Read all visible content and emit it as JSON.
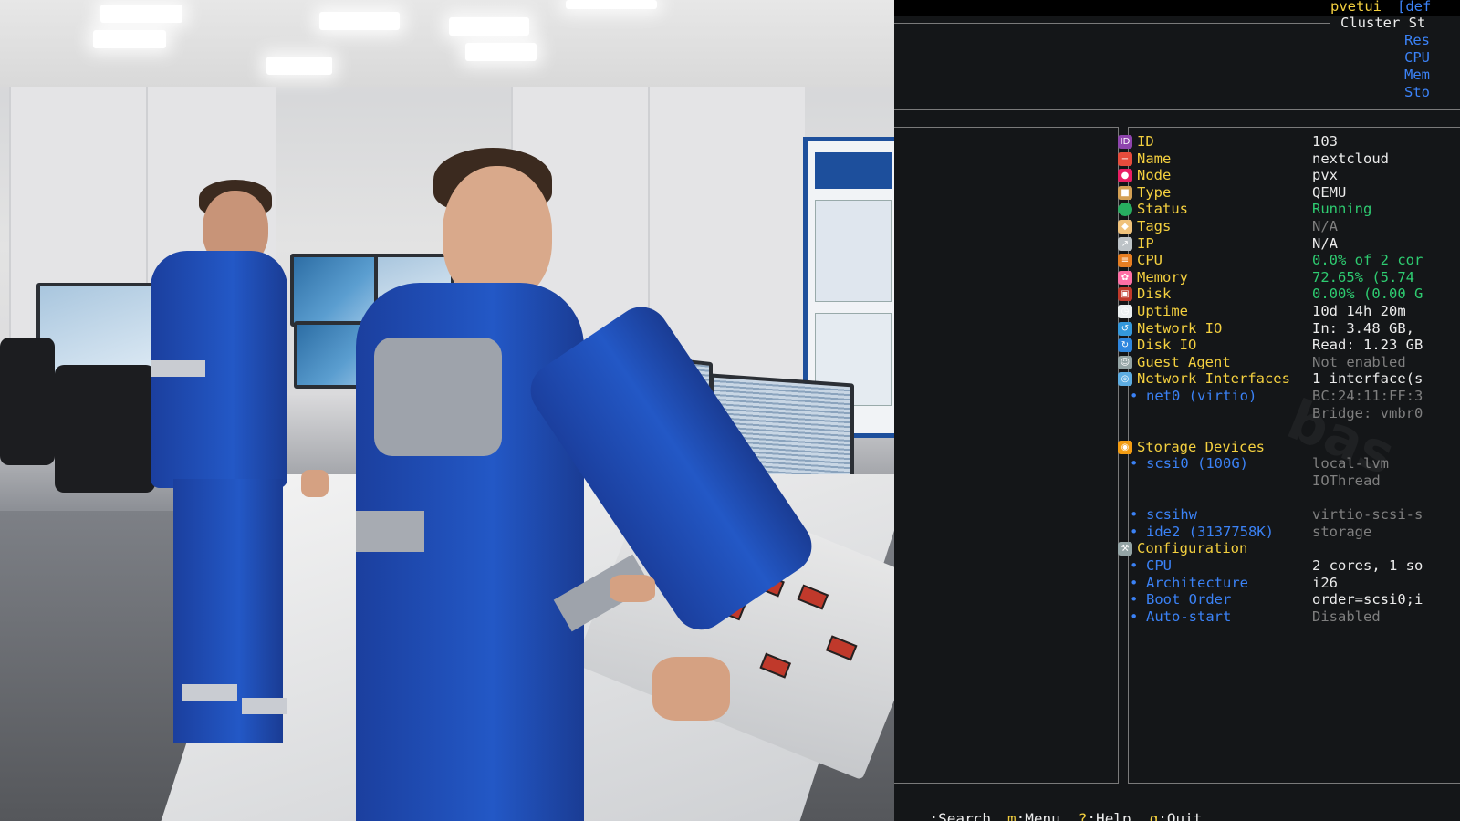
{
  "terminal": {
    "header": {
      "app_title": "pvetui",
      "profile_fragment": "[def",
      "cluster_label": "Cluster St",
      "cluster_items": [
        "Res",
        "CPU",
        "Mem",
        "Sto"
      ]
    },
    "details": [
      {
        "label": "ID",
        "value": "103",
        "label_color": "#f4d03f",
        "value_color": "#ececec",
        "icon": "id-icon",
        "icon_color": "#8e44ad"
      },
      {
        "label": "Name",
        "value": "nextcloud",
        "label_color": "#f4d03f",
        "value_color": "#ececec",
        "icon": "no-entry-icon",
        "icon_color": "#e74c3c"
      },
      {
        "label": "Node",
        "value": "pvx",
        "label_color": "#f4d03f",
        "value_color": "#ececec",
        "icon": "pin-icon",
        "icon_color": "#e91e63"
      },
      {
        "label": "Type",
        "value": "QEMU",
        "label_color": "#f4d03f",
        "value_color": "#ececec",
        "icon": "package-icon",
        "icon_color": "#d4a054"
      },
      {
        "label": "Status",
        "value": "Running",
        "label_color": "#f4d03f",
        "value_color": "#2ecc71",
        "icon": "green-circle-icon",
        "icon_color": "#27ae60"
      },
      {
        "label": "Tags",
        "value": "N/A",
        "label_color": "#f4d03f",
        "value_color": "#7f7f7f",
        "icon": "tag-icon",
        "icon_color": "#f0c27b"
      },
      {
        "label": "IP",
        "value": "N/A",
        "label_color": "#f4d03f",
        "value_color": "#ececec",
        "icon": "satellite-icon",
        "icon_color": "#bdc3c7"
      },
      {
        "label": "CPU",
        "value": "0.0% of 2 cor",
        "label_color": "#f4d03f",
        "value_color": "#2ecc71",
        "icon": "abacus-icon",
        "icon_color": "#e67e22"
      },
      {
        "label": "Memory",
        "value": "72.65% (5.74",
        "label_color": "#f4d03f",
        "value_color": "#2ecc71",
        "icon": "brain-icon",
        "icon_color": "#ff6fa5"
      },
      {
        "label": "Disk",
        "value": "0.00% (0.00 G",
        "label_color": "#f4d03f",
        "value_color": "#2ecc71",
        "icon": "floppy-disk-icon",
        "icon_color": "#c0392b"
      },
      {
        "label": "Uptime",
        "value": "10d 14h 20m",
        "label_color": "#f4d03f",
        "value_color": "#ececec",
        "icon": "clock-icon",
        "icon_color": "#ecf0f1"
      },
      {
        "label": "Network IO",
        "value": "In: 3.48 GB,",
        "label_color": "#f4d03f",
        "value_color": "#ececec",
        "icon": "arrows-refresh-icon",
        "icon_color": "#3498db"
      },
      {
        "label": "Disk IO",
        "value": "Read: 1.23 GB",
        "label_color": "#f4d03f",
        "value_color": "#ececec",
        "icon": "cycle-icon",
        "icon_color": "#2e86de"
      },
      {
        "label": "Guest Agent",
        "value": "Not enabled",
        "label_color": "#f4d03f",
        "value_color": "#7f7f7f",
        "icon": "robot-icon",
        "icon_color": "#95a5a6"
      },
      {
        "label": "Network Interfaces",
        "value": "1 interface(s",
        "label_color": "#f4d03f",
        "value_color": "#ececec",
        "icon": "globe-icon",
        "icon_color": "#5dade2"
      }
    ],
    "net_sub": {
      "name": "net0 (virtio)",
      "line1": "BC:24:11:FF:3",
      "line2": "Bridge: vmbr0"
    },
    "storage": {
      "label": "Storage Devices",
      "icon": "disc-icon",
      "icon_color": "#f39c12"
    },
    "storage_items": [
      {
        "name": "scsi0 (100G)",
        "value": "local-lvm",
        "value2": "IOThread"
      },
      {
        "name": "scsihw",
        "value": "virtio-scsi-s",
        "value2": ""
      },
      {
        "name": "ide2 (3137758K)",
        "value": "storage",
        "value2": ""
      }
    ],
    "config": {
      "label": "Configuration",
      "icon": "hammer-icon",
      "icon_color": "#95a5a6"
    },
    "config_items": [
      {
        "name": "CPU",
        "value": "2 cores, 1 so",
        "value_color": "#ececec"
      },
      {
        "name": "Architecture",
        "value": "i26",
        "value_color": "#ececec"
      },
      {
        "name": "Boot Order",
        "value": "order=scsi0;i",
        "value_color": "#ececec"
      },
      {
        "name": "Auto-start",
        "value": "Disabled",
        "value_color": "#7f7f7f"
      }
    ],
    "watermark": "bas",
    "footer": [
      {
        "key": "",
        "label": ":Search"
      },
      {
        "key": "m",
        "label": ":Menu"
      },
      {
        "key": "?",
        "label": ":Help"
      },
      {
        "key": "q",
        "label": ":Quit"
      }
    ]
  },
  "colors": {
    "label_yellow": "#f4d03f",
    "link_blue": "#3b82f6",
    "ok_green": "#2ecc71",
    "muted_gray": "#7f7f7f",
    "terminal_bg": "#141618"
  }
}
